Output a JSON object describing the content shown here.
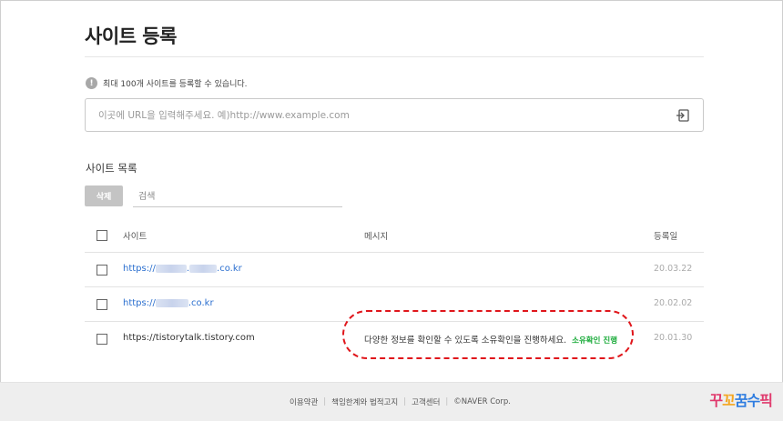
{
  "page": {
    "title": "사이트 등록",
    "notice_icon": "!",
    "notice": "최대 100개 사이트를 등록할 수 있습니다.",
    "url_placeholder": "이곳에 URL을 입력해주세요. 예)http://www.example.com",
    "submit_icon": "enter-icon"
  },
  "list": {
    "title": "사이트 목록",
    "delete_label": "삭제",
    "search_placeholder": "검색",
    "headers": {
      "site": "사이트",
      "message": "메시지",
      "date": "등록일"
    },
    "rows": [
      {
        "site_prefix": "https://",
        "site_suffix": ".co.kr",
        "message": "",
        "verify": "",
        "date": "20.03.22"
      },
      {
        "site_prefix": "https://",
        "site_suffix": ".co.kr",
        "message": "",
        "verify": "",
        "date": "20.02.02"
      },
      {
        "site_prefix": "https://tistorytalk.tistory.com",
        "site_suffix": "",
        "message": "다양한 정보를 확인할 수 있도록 소유확인을 진행하세요.",
        "verify": "소유확인 진행",
        "date": "20.01.30"
      }
    ]
  },
  "footer": {
    "links": [
      "이용약관",
      "책임한계와 법적고지",
      "고객센터",
      "©NAVER Corp."
    ],
    "watermark": "꾸꼬꿈수픽"
  },
  "colors": {
    "link": "#2b6fcf",
    "verify": "#1aab3a",
    "highlight": "#e0161b"
  }
}
